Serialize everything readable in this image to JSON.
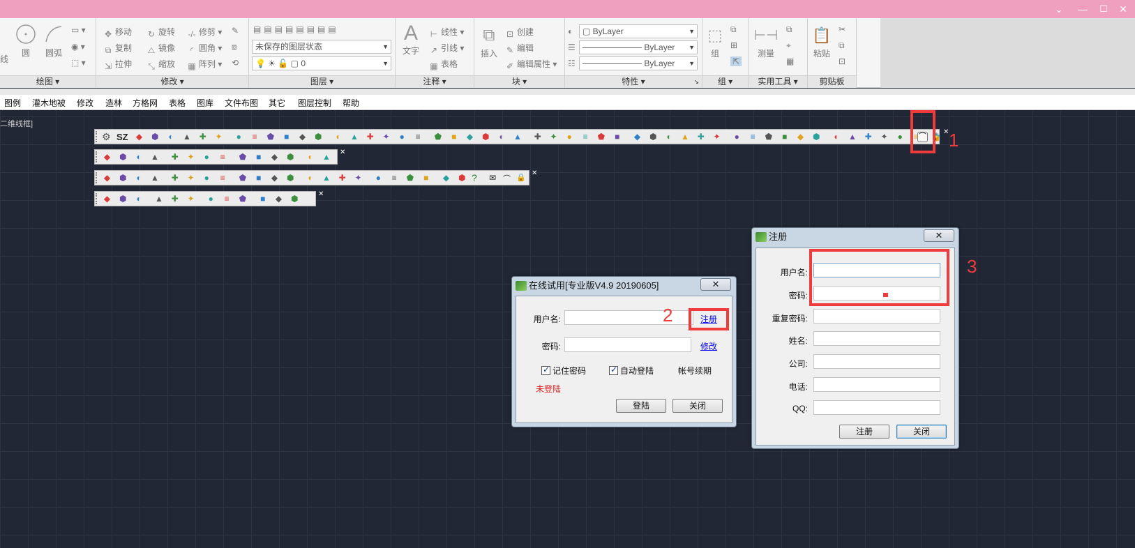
{
  "window": {
    "minimize_icon": "chevron-down",
    "controls": [
      "—",
      "☐",
      "✕"
    ]
  },
  "ribbon": {
    "panels": {
      "draw": {
        "label": "绘图",
        "tools": [
          "线",
          "圆",
          "圆弧"
        ]
      },
      "modify": {
        "label": "修改",
        "tools": [
          "移动",
          "旋转",
          "修剪",
          "复制",
          "镜像",
          "圆角",
          "拉伸",
          "缩放",
          "阵列"
        ]
      },
      "layers": {
        "label": "图层",
        "layer_state": "未保存的图层状态",
        "layer_current": "0"
      },
      "annotation": {
        "label": "注释",
        "big": "文字",
        "tools": [
          "线性",
          "引线",
          "表格"
        ]
      },
      "block": {
        "label": "块",
        "big": "插入",
        "tools": [
          "创建",
          "编辑",
          "编辑属性"
        ]
      },
      "properties": {
        "label": "特性",
        "color": "ByLayer",
        "linetype": "ByLayer",
        "lineweight": "ByLayer"
      },
      "group": {
        "label": "组",
        "big": "组"
      },
      "utilities": {
        "label": "实用工具",
        "big": "测量"
      },
      "clipboard": {
        "label": "剪贴板",
        "big": "粘贴"
      }
    }
  },
  "menubar": {
    "items": [
      "图例",
      "灌木地被",
      "修改",
      "造林",
      "方格网",
      "表格",
      "图库",
      "文件布图",
      "其它",
      "图层控制",
      "帮助"
    ]
  },
  "viewport_label": "二维线框]",
  "toolbars": {
    "row1_text": "SZ"
  },
  "login_dialog": {
    "title": "在线试用[专业版V4.9 20190605]",
    "close_label": "✕",
    "username_label": "用户名:",
    "password_label": "密码:",
    "register_link": "注册",
    "modify_link": "修改",
    "remember_label": "记住密码",
    "remember_checked": true,
    "autologin_label": "自动登陆",
    "autologin_checked": true,
    "renew_label": "帐号续期",
    "status_text": "未登陆",
    "status_color": "#e02020",
    "login_button": "登陆",
    "close_button": "关闭"
  },
  "register_dialog": {
    "title": "注册",
    "close_label": "✕",
    "fields": [
      {
        "label": "用户名:",
        "value": ""
      },
      {
        "label": "密码:",
        "value": ""
      },
      {
        "label": "重复密码:",
        "value": ""
      },
      {
        "label": "姓名:",
        "value": ""
      },
      {
        "label": "公司:",
        "value": ""
      },
      {
        "label": "电话:",
        "value": ""
      },
      {
        "label": "QQ:",
        "value": ""
      }
    ],
    "register_button": "注册",
    "close_button": "关闭"
  },
  "annotations": {
    "one": "1",
    "two": "2",
    "three": "3",
    "color": "#ef3b3b"
  }
}
